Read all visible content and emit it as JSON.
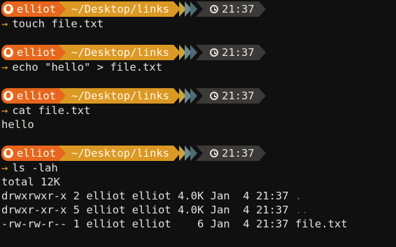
{
  "prompt": {
    "user": "elliot",
    "path": "~/Desktop/links",
    "time": "21:37",
    "arrow": "→",
    "user_icon": "user-icon",
    "time_icon": "clock-icon"
  },
  "blocks": [
    {
      "command": "touch file.txt",
      "output": []
    },
    {
      "command": "echo \"hello\" > file.txt",
      "output": []
    },
    {
      "command": "cat file.txt",
      "output": [
        "hello"
      ]
    },
    {
      "command": "ls -lah",
      "output": [
        "total 12K",
        "drwxrwxr-x 2 elliot elliot 4.0K Jan  4 21:37 ",
        "drwxr-xr-x 5 elliot elliot 4.0K Jan  4 21:37 ",
        "-rw-rw-r-- 1 elliot elliot    6 Jan  4 21:37 file.txt"
      ],
      "dir_names": [
        ".",
        ".."
      ]
    }
  ],
  "colors": {
    "background": "#101010",
    "user_segment": "#e6661d",
    "path_segment": "#db9823",
    "time_segment": "#3b3a38",
    "arrow": "#e3a42a",
    "dir_link": "#3e6fa5"
  }
}
